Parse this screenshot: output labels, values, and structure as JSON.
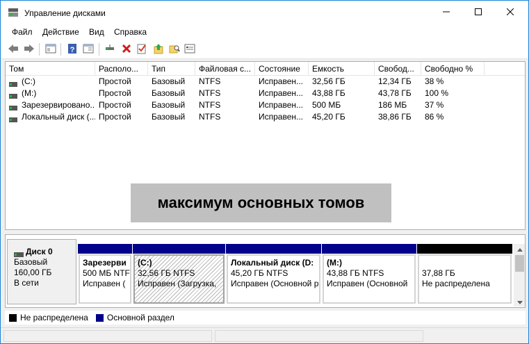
{
  "window": {
    "title": "Управление дисками"
  },
  "menu": {
    "items": [
      "Файл",
      "Действие",
      "Вид",
      "Справка"
    ]
  },
  "toolbar": {
    "buttons": [
      "back-icon",
      "forward-icon",
      "console-tree-icon",
      "help-icon",
      "properties-icon",
      "connect-icon",
      "delete-icon",
      "check-icon",
      "up-folder-icon",
      "search-folder-icon",
      "export-icon"
    ]
  },
  "volumes": {
    "columns": [
      "Том",
      "Располо...",
      "Тип",
      "Файловая с...",
      "Состояние",
      "Емкость",
      "Свобод...",
      "Свободно %"
    ],
    "rows": [
      [
        "(C:)",
        "Простой",
        "Базовый",
        "NTFS",
        "Исправен...",
        "32,56 ГБ",
        "12,34 ГБ",
        "38 %"
      ],
      [
        "(M:)",
        "Простой",
        "Базовый",
        "NTFS",
        "Исправен...",
        "43,88 ГБ",
        "43,78 ГБ",
        "100 %"
      ],
      [
        "Зарезервировано...",
        "Простой",
        "Базовый",
        "NTFS",
        "Исправен...",
        "500 МБ",
        "186 МБ",
        "37 %"
      ],
      [
        "Локальный диск (...",
        "Простой",
        "Базовый",
        "NTFS",
        "Исправен...",
        "45,20 ГБ",
        "38,86 ГБ",
        "86 %"
      ]
    ]
  },
  "overlay": {
    "text": "максимум основных томов"
  },
  "disk": {
    "name": "Диск 0",
    "type": "Базовый",
    "size": "160,00 ГБ",
    "status": "В сети",
    "partitions": [
      {
        "name": "Зарезерви",
        "size": "500 МБ NTFS",
        "status": "Исправен (",
        "bar_color": "#00008b",
        "selected": false
      },
      {
        "name": "(C:)",
        "size": "32,56 ГБ NTFS",
        "status": "Исправен (Загрузка, ",
        "bar_color": "#00008b",
        "selected": true
      },
      {
        "name": "Локальный диск  (D:",
        "size": "45,20 ГБ NTFS",
        "status": "Исправен (Основной р",
        "bar_color": "#00008b",
        "selected": false
      },
      {
        "name": "(M:)",
        "size": "43,88 ГБ NTFS",
        "status": "Исправен (Основной",
        "bar_color": "#00008b",
        "selected": false
      },
      {
        "name": "",
        "size": "37,88 ГБ",
        "status": "Не распределена",
        "bar_color": "#000000",
        "selected": false
      }
    ]
  },
  "legend": {
    "items": [
      {
        "label": "Не распределена",
        "color": "#000000"
      },
      {
        "label": "Основной раздел",
        "color": "#00008b"
      }
    ]
  }
}
